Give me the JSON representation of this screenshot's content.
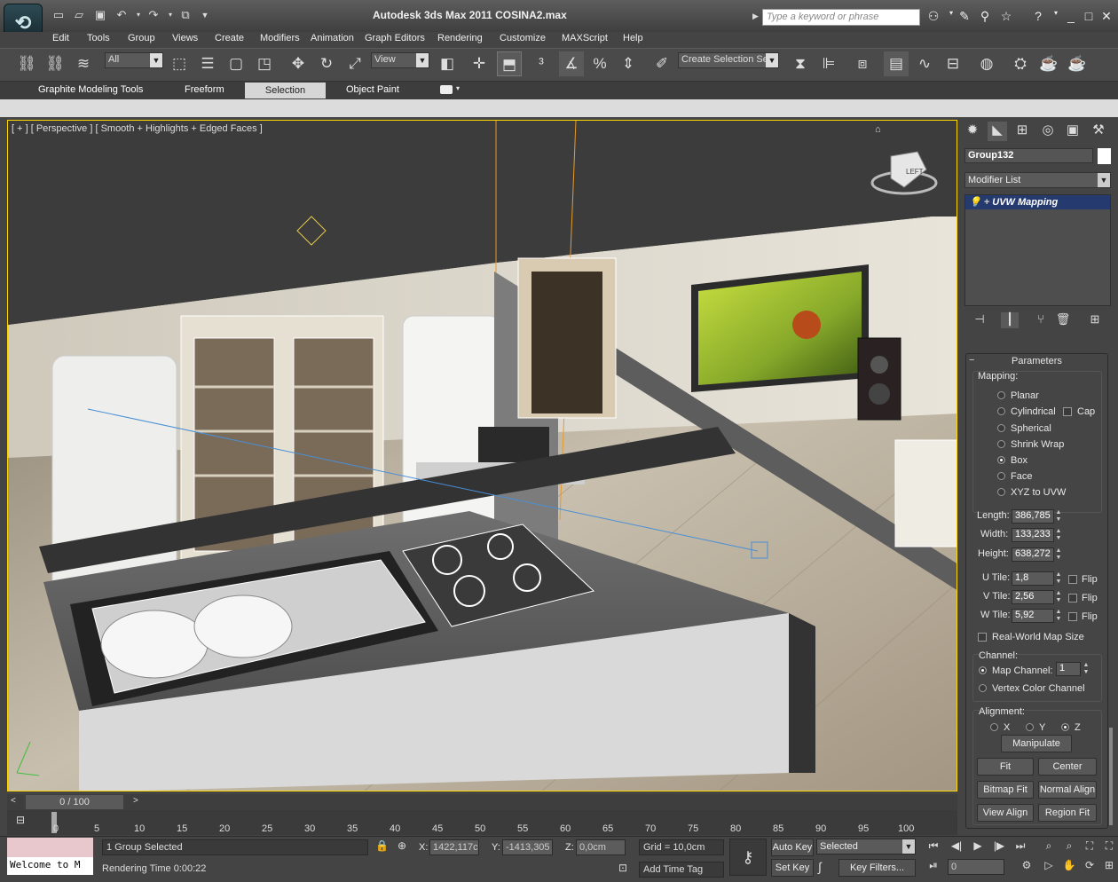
{
  "window": {
    "title": "Autodesk 3ds Max  2011      COSINA2.max"
  },
  "search": {
    "placeholder": "Type a keyword or phrase"
  },
  "menu": [
    "Edit",
    "Tools",
    "Group",
    "Views",
    "Create",
    "Modifiers",
    "Animation",
    "Graph Editors",
    "Rendering",
    "Customize",
    "MAXScript",
    "Help"
  ],
  "toolbar": {
    "filter_value": "All",
    "refcoord_value": "View",
    "selection_set": "Create Selection Se"
  },
  "ribbon": {
    "tabs": [
      "Graphite Modeling Tools",
      "Freeform",
      "Selection",
      "Object Paint"
    ],
    "active": "Selection"
  },
  "viewport": {
    "label": "[ + ] [ Perspective ] [ Smooth + Highlights + Edged Faces ]",
    "viewcube_face": "LEFT"
  },
  "command_panel": {
    "object_name": "Group132",
    "modifier_list": "Modifier List",
    "stack_item": "UVW Mapping",
    "parameters": {
      "rollout_title": "Parameters",
      "mapping_label": "Mapping:",
      "mapping_options": [
        "Planar",
        "Cylindrical",
        "Spherical",
        "Shrink Wrap",
        "Box",
        "Face",
        "XYZ to UVW"
      ],
      "mapping_selected": "Box",
      "cap_label": "Cap",
      "length_label": "Length:",
      "length": "386,785",
      "width_label": "Width:",
      "width": "133,233",
      "height_label": "Height:",
      "height": "638,272",
      "utile_label": "U Tile:",
      "utile": "1,8",
      "vtile_label": "V Tile:",
      "vtile": "2,56",
      "wtile_label": "W Tile:",
      "wtile": "5,92",
      "flip_label": "Flip",
      "realworld_label": "Real-World Map Size",
      "channel_label": "Channel:",
      "map_channel_label": "Map Channel:",
      "map_channel": "1",
      "vertex_color_label": "Vertex Color Channel",
      "alignment_label": "Alignment:",
      "align_axes": [
        "X",
        "Y",
        "Z"
      ],
      "align_selected": "Z",
      "buttons": {
        "manipulate": "Manipulate",
        "fit": "Fit",
        "center": "Center",
        "bitmap_fit": "Bitmap Fit",
        "normal_align": "Normal Align",
        "view_align": "View Align",
        "region_fit": "Region Fit"
      }
    }
  },
  "timeline": {
    "slider": "0 / 100",
    "ticks": [
      "0",
      "5",
      "10",
      "15",
      "20",
      "25",
      "30",
      "35",
      "40",
      "45",
      "50",
      "55",
      "60",
      "65",
      "70",
      "75",
      "80",
      "85",
      "90",
      "95",
      "100"
    ]
  },
  "status": {
    "listener_text": "Welcome to M",
    "selection": "1 Group Selected",
    "prompt": "Rendering Time  0:00:22",
    "x_label": "X:",
    "x": "1422,117c",
    "y_label": "Y:",
    "y": "-1413,305",
    "z_label": "Z:",
    "z": "0,0cm",
    "grid": "Grid = 10,0cm",
    "add_time_tag": "Add Time Tag",
    "auto_key": "Auto Key",
    "selected": "Selected",
    "set_key": "Set Key",
    "key_filters": "Key Filters...",
    "frame": "0"
  }
}
